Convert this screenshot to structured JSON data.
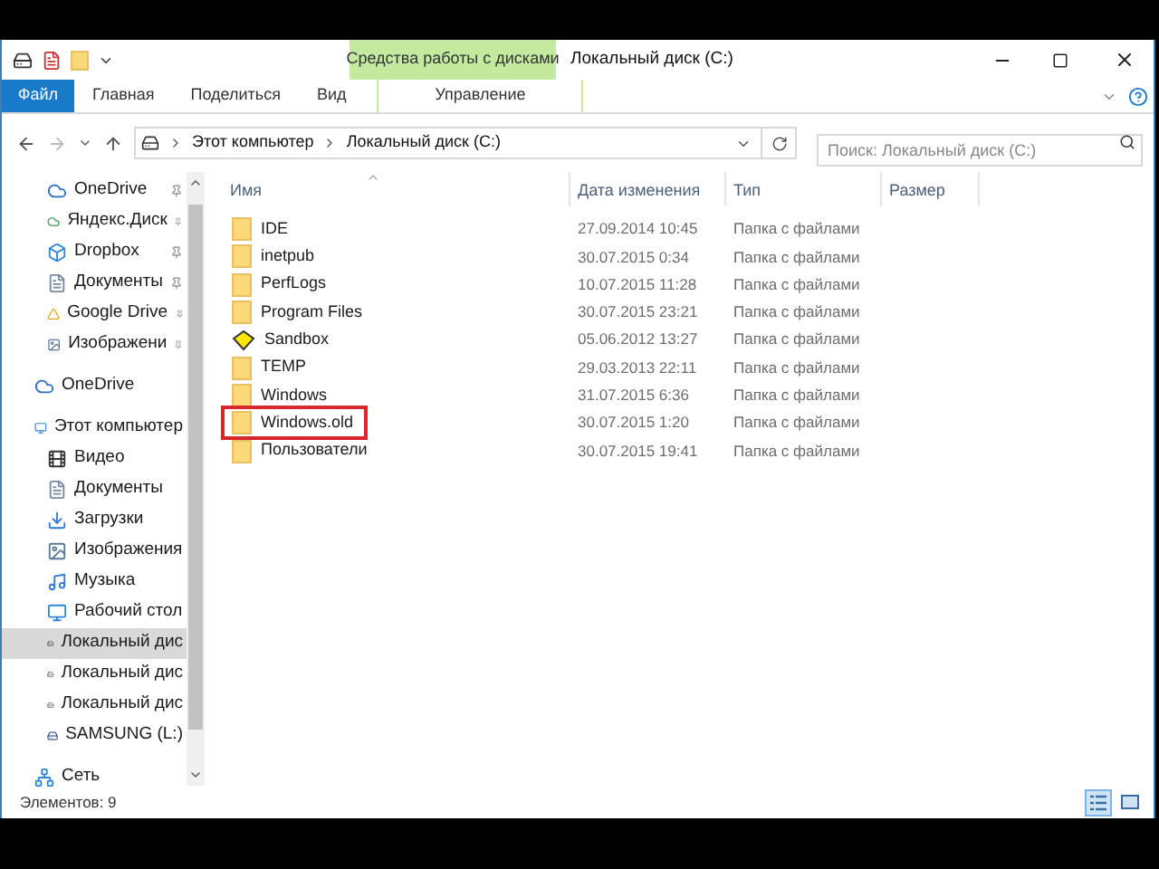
{
  "window": {
    "title": "Локальный диск (C:)"
  },
  "ribbon": {
    "tabs": [
      {
        "label": "Файл",
        "kind": "file",
        "selected": false
      },
      {
        "label": "Главная",
        "kind": "tab",
        "selected": false
      },
      {
        "label": "Поделиться",
        "kind": "tab",
        "selected": false
      },
      {
        "label": "Вид",
        "kind": "tab",
        "selected": false
      },
      {
        "label": "Управление",
        "kind": "context",
        "selected": false
      }
    ],
    "context_header": "Средства работы с дисками"
  },
  "address": {
    "crumbs": [
      "Этот компьютер",
      "Локальный диск (C:)"
    ]
  },
  "search": {
    "placeholder": "Поиск: Локальный диск (C:)"
  },
  "sidebar": {
    "groups": [
      {
        "items": [
          {
            "label": "OneDrive",
            "pinned": true,
            "selected": false
          },
          {
            "label": "Яндекс.Диск",
            "pinned": true,
            "selected": false
          },
          {
            "label": "Dropbox",
            "pinned": true,
            "selected": false
          },
          {
            "label": "Документы",
            "pinned": true,
            "selected": false
          },
          {
            "label": "Google Drive",
            "pinned": true,
            "selected": false
          },
          {
            "label": "Изображени",
            "pinned": true,
            "selected": false
          }
        ]
      },
      {
        "items": [
          {
            "label": "OneDrive",
            "pinned": false,
            "selected": false
          }
        ]
      },
      {
        "items": [
          {
            "label": "Этот компьютер",
            "pinned": false,
            "selected": false,
            "children": [
              {
                "label": "Видео",
                "pinned": false,
                "selected": false
              },
              {
                "label": "Документы",
                "pinned": false,
                "selected": false
              },
              {
                "label": "Загрузки",
                "pinned": false,
                "selected": false
              },
              {
                "label": "Изображения",
                "pinned": false,
                "selected": false
              },
              {
                "label": "Музыка",
                "pinned": false,
                "selected": false
              },
              {
                "label": "Рабочий стол",
                "pinned": false,
                "selected": false
              },
              {
                "label": "Локальный дис",
                "pinned": false,
                "selected": true
              },
              {
                "label": "Локальный дис",
                "pinned": false,
                "selected": false
              },
              {
                "label": "Локальный дис",
                "pinned": false,
                "selected": false
              },
              {
                "label": "SAMSUNG (L:)",
                "pinned": false,
                "selected": false
              }
            ]
          }
        ]
      },
      {
        "items": [
          {
            "label": "Сеть",
            "pinned": false,
            "selected": false
          }
        ]
      }
    ]
  },
  "table": {
    "columns": [
      {
        "label": "Имя",
        "sorted": true
      },
      {
        "label": "Дата изменения",
        "sorted": false
      },
      {
        "label": "Тип",
        "sorted": false
      },
      {
        "label": "Размер",
        "sorted": false
      }
    ],
    "rows": [
      {
        "name": "IDE",
        "date": "27.09.2014 10:45",
        "type": "Папка с файлами",
        "kind": "folder",
        "highlighted": false
      },
      {
        "name": "inetpub",
        "date": "30.07.2015 0:34",
        "type": "Папка с файлами",
        "kind": "folder",
        "highlighted": false
      },
      {
        "name": "PerfLogs",
        "date": "10.07.2015 11:28",
        "type": "Папка с файлами",
        "kind": "folder",
        "highlighted": false
      },
      {
        "name": "Program Files",
        "date": "30.07.2015 23:21",
        "type": "Папка с файлами",
        "kind": "folder",
        "highlighted": false
      },
      {
        "name": "Sandbox",
        "date": "05.06.2012 13:27",
        "type": "Папка с файлами",
        "kind": "sandbox",
        "highlighted": false
      },
      {
        "name": "TEMP",
        "date": "29.03.2013 22:11",
        "type": "Папка с файлами",
        "kind": "folder",
        "highlighted": false
      },
      {
        "name": "Windows",
        "date": "31.07.2015 6:36",
        "type": "Папка с файлами",
        "kind": "folder",
        "highlighted": false
      },
      {
        "name": "Windows.old",
        "date": "30.07.2015 1:20",
        "type": "Папка с файлами",
        "kind": "folder",
        "highlighted": true
      },
      {
        "name": "Пользователи",
        "date": "30.07.2015 19:41",
        "type": "Папка с файлами",
        "kind": "folder",
        "highlighted": false
      }
    ]
  },
  "status_bar": {
    "text": "Элементов: 9",
    "views": [
      {
        "kind": "details",
        "selected": true
      },
      {
        "kind": "tiles",
        "selected": false
      }
    ]
  }
}
